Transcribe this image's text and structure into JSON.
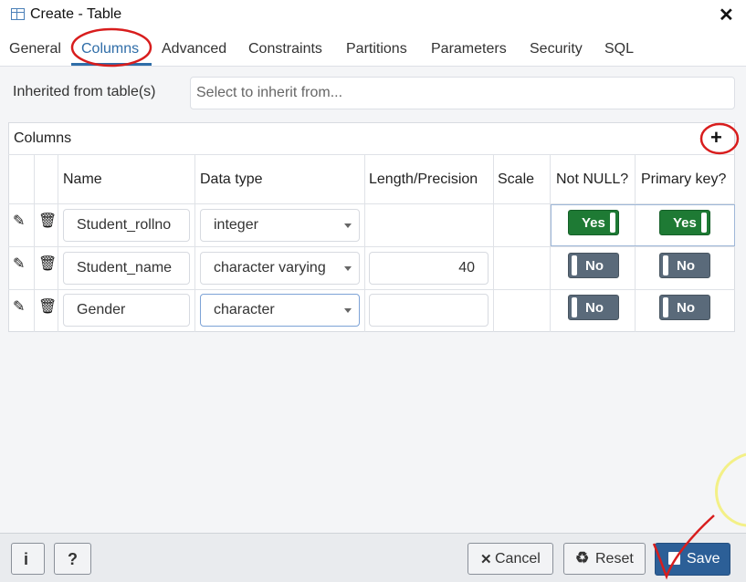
{
  "window": {
    "title": "Create - Table",
    "close_icon": "close-icon"
  },
  "tabs": [
    "General",
    "Columns",
    "Advanced",
    "Constraints",
    "Partitions",
    "Parameters",
    "Security",
    "SQL"
  ],
  "active_tab": "Columns",
  "inherit": {
    "label": "Inherited from table(s)",
    "placeholder": "Select to inherit from..."
  },
  "columns_grid": {
    "title": "Columns",
    "add_label": "+",
    "headers": [
      "Name",
      "Data type",
      "Length/Precision",
      "Scale",
      "Not NULL?",
      "Primary key?"
    ],
    "rows": [
      {
        "name": "Student_rollno",
        "data_type": "integer",
        "length": "",
        "scale": "",
        "not_null": "Yes",
        "primary_key": "Yes"
      },
      {
        "name": "Student_name",
        "data_type": "character varying",
        "length": "40",
        "scale": "",
        "not_null": "No",
        "primary_key": "No"
      },
      {
        "name": "Gender",
        "data_type": "character",
        "length": "",
        "scale": "",
        "not_null": "No",
        "primary_key": "No"
      }
    ]
  },
  "footer": {
    "info_label": "i",
    "help_label": "?",
    "cancel_label": "Cancel",
    "reset_label": "Reset",
    "save_label": "Save"
  },
  "colors": {
    "accent": "#2f6da8",
    "toggle_on": "#1e7a34",
    "toggle_off": "#5a6a7a",
    "save": "#2c5f97",
    "annotation": "#d81d1d"
  }
}
